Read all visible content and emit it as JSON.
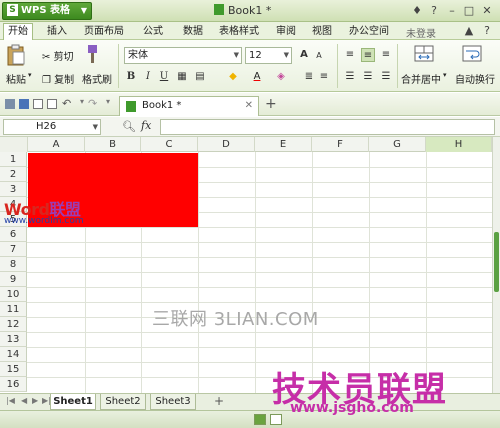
{
  "app": {
    "name": "WPS 表格",
    "logo_char": "S"
  },
  "window": {
    "title": "Book1 *"
  },
  "menu": {
    "items": [
      "开始",
      "插入",
      "页面布局",
      "公式",
      "数据",
      "表格样式",
      "审阅",
      "视图",
      "办公空间"
    ],
    "login": "未登录"
  },
  "ribbon": {
    "cut": "剪切",
    "copy": "复制",
    "paste": "粘贴",
    "format_painter": "格式刷",
    "font_name": "宋体",
    "font_size": "12",
    "bold": "B",
    "italic": "I",
    "underline": "U",
    "font_color_letter": "A",
    "merge_center": "合并居中",
    "autowrap": "自动换行"
  },
  "doc_tab": {
    "label": "Book1 *"
  },
  "formula_bar": {
    "cell_ref": "H26",
    "fx": "fx",
    "value": ""
  },
  "grid": {
    "columns": [
      "A",
      "B",
      "C",
      "D",
      "E",
      "F",
      "G",
      "H"
    ],
    "selected_column": "H",
    "rows": [
      "1",
      "2",
      "3",
      "4",
      "5",
      "6",
      "7",
      "8",
      "9",
      "10",
      "11",
      "12",
      "13",
      "14",
      "15",
      "16"
    ],
    "fill_color": "#ff0000"
  },
  "sheets": {
    "tabs": [
      "Sheet1",
      "Sheet2",
      "Sheet3"
    ],
    "active": "Sheet1",
    "add": "+"
  },
  "watermarks": {
    "word_a": "Word",
    "word_b": "联盟",
    "word_url": "www.wordlm.com",
    "sanlian": "三联网 3LIAN.COM",
    "jsgho_title": "技术员联盟",
    "jsgho_url": "www.jsgho.com"
  },
  "colors": {
    "accent": "#3d8a1f",
    "ribbon_bg": "#eaf2de",
    "selected_header": "#d7e9c0"
  }
}
